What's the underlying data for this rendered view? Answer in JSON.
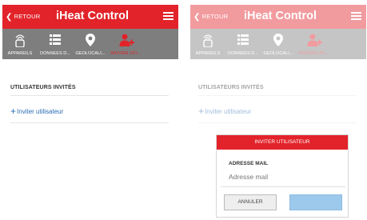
{
  "header": {
    "back_label": "RETOUR",
    "title": "iHeat Control"
  },
  "tabs": [
    {
      "label": "APPAREILS",
      "icon": "device-icon"
    },
    {
      "label": "DONNÉES D...",
      "icon": "list-icon"
    },
    {
      "label": "GÉOLOCALI...",
      "icon": "location-pin-icon"
    },
    {
      "label": "INVITER UTI...",
      "icon": "add-user-icon",
      "active": true
    }
  ],
  "section": {
    "title": "UTILISATEURS INVITÉS",
    "invite_label": "Inviter utilisateur"
  },
  "modal": {
    "title": "INVITER UTILISATEUR",
    "field_label": "ADRESSE MAIL",
    "field_placeholder": "Adresse mail",
    "cancel_label": "ANNULER"
  },
  "colors": {
    "brand_red": "#e2232a",
    "tabbar_gray": "#7e7e7e",
    "link_blue": "#2a6cb5",
    "confirm_blue": "#9dc9ec"
  }
}
